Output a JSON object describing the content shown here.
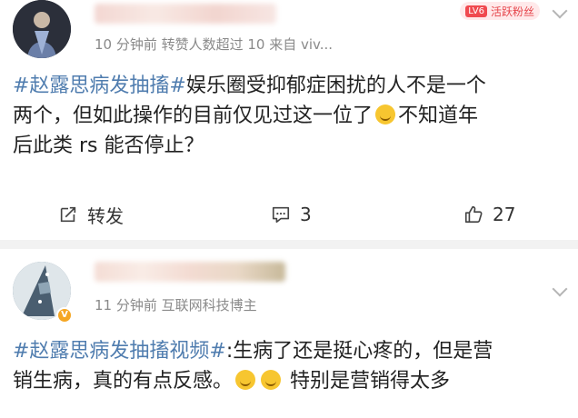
{
  "post1": {
    "meta": "10 分钟前  转赞人数超过 10  来自 viv...",
    "badge": {
      "level": "LV6",
      "label": "活跃粉丝"
    },
    "content": {
      "tag": "#赵露思病发抽搐#",
      "line1_rest": "娱乐圈受抑郁症困扰的人不是一个",
      "line2": "两个，但如此操作的目前仅见过这一位了",
      "line2_after_emoji": "不知道年",
      "line3": "后此类 rs 能否停止？"
    },
    "actions": {
      "share_label": "转发",
      "comment_count": "3",
      "like_count": "27"
    }
  },
  "post2": {
    "meta": "11 分钟前   互联网科技博主",
    "content": {
      "tag": "#赵露思病发抽搐视频#",
      "line1_rest": ":生病了还是挺心疼的，但是营",
      "line2_before_emoji": "销生病，真的有点反感。",
      "line2_after_emoji": "特别是营销得太多"
    }
  },
  "icons": {
    "share": "share-icon",
    "comment": "comment-icon",
    "like": "thumbs-up-icon",
    "more": "chevron-down-icon",
    "verified": "verified-v-icon"
  },
  "colors": {
    "hashtag": "#507daf",
    "meta_gray": "#8a8a8a",
    "badge_red": "#e6454b",
    "divider": "#f2f2f2"
  }
}
